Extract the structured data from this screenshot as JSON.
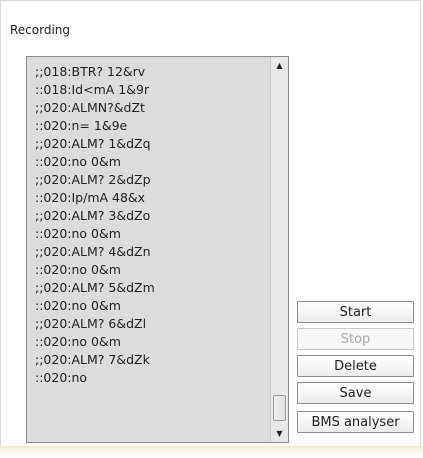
{
  "group": {
    "title": "Recording"
  },
  "listbox": {
    "first_line_partial": "'",
    "lines": [
      ";;018:BTR? 12&rv",
      "::018:Id<mA 1&9r",
      ";;020:ALMN?&dZt",
      "::020:n= 1&9e",
      ";;020:ALM? 1&dZq",
      "::020:no 0&m",
      ";;020:ALM? 2&dZp",
      "::020:Ip/mA 48&x",
      ";;020:ALM? 3&dZo",
      "::020:no 0&m",
      ";;020:ALM? 4&dZn",
      "::020:no 0&m",
      ";;020:ALM? 5&dZm",
      "::020:no 0&m",
      ";;020:ALM? 6&dZl",
      "::020:no 0&m",
      ";;020:ALM? 7&dZk",
      "::020:no"
    ]
  },
  "buttons": {
    "start": "Start",
    "stop": "Stop",
    "delete": "Delete",
    "save": "Save",
    "bms": "BMS analyser"
  },
  "icons": {
    "scroll_up": "triangle-up",
    "scroll_down": "triangle-down"
  },
  "colors": {
    "list_background": "#dcdcdc",
    "disabled_text": "#a8a8a8"
  }
}
